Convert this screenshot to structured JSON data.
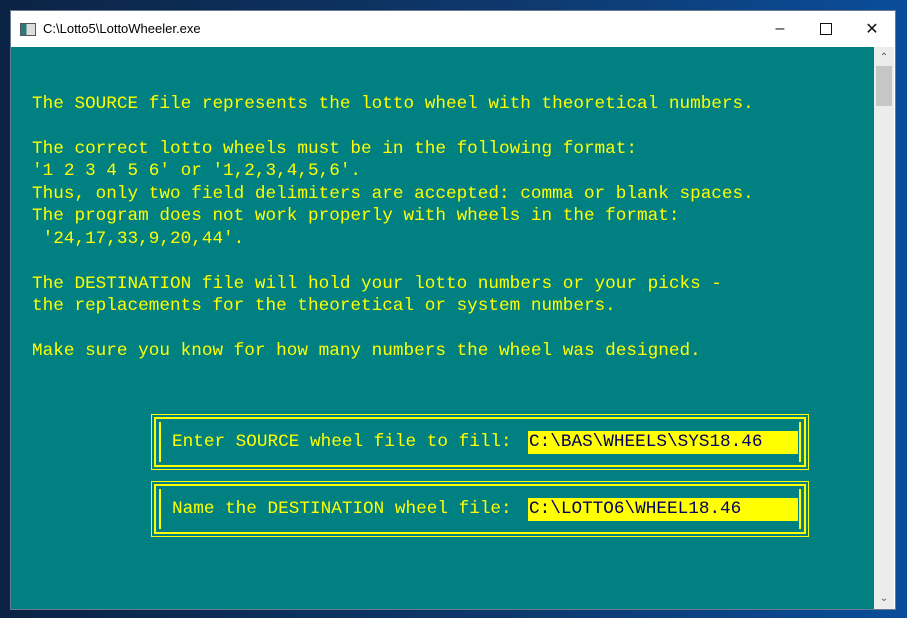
{
  "window": {
    "title": "C:\\Lotto5\\LottoWheeler.exe",
    "minimize_icon": "minimize-icon",
    "maximize_icon": "maximize-icon",
    "close_icon": "close-icon"
  },
  "colors": {
    "background": "#008080",
    "text": "#ffff00",
    "field_bg": "#ffff00",
    "field_text": "#000060"
  },
  "text_lines": [
    "The SOURCE file represents the lotto wheel with theoretical numbers.",
    "The correct lotto wheels must be in the following format:",
    "'1 2 3 4 5 6' or '1,2,3,4,5,6'.",
    "Thus, only two field delimiters are accepted: comma or blank spaces.",
    "The program does not work properly with wheels in the format:",
    " '24,17,33,9,20,44'.",
    "The DESTINATION file will hold your lotto numbers or your picks -",
    "the replacements for the theoretical or system numbers.",
    "Make sure you know for how many numbers the wheel was designed."
  ],
  "source_prompt": {
    "label": "Enter SOURCE wheel file to fill:",
    "value": "C:\\BAS\\WHEELS\\SYS18.46"
  },
  "destination_prompt": {
    "label": "Name the DESTINATION wheel file:",
    "value": "C:\\LOTTO6\\WHEEL18.46"
  }
}
